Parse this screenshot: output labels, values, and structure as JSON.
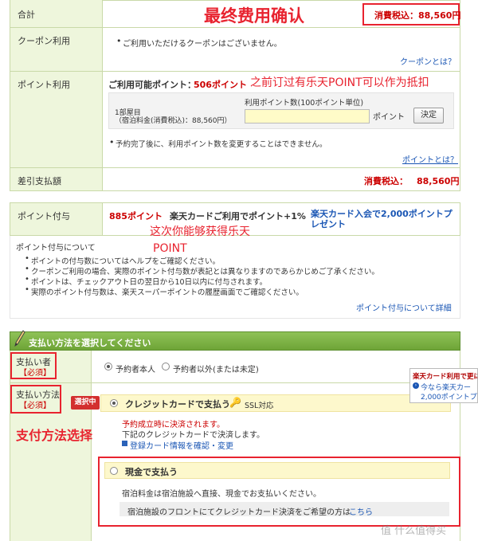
{
  "summary": {
    "total_label": "合計",
    "total_annotation": "最终费用确认",
    "total_value": "消費税込：88,560円",
    "coupon_label": "クーポン利用",
    "coupon_note": "ご利用いただけるクーポンはございません。",
    "coupon_link": "クーポンとは？",
    "point_label": "ポイント利用",
    "point_available_prefix": "ご利用可能ポイント：",
    "point_available_value": "506ポイント",
    "point_annotation": "之前订过有乐天POINT可以作为抵扣",
    "room_label": "1部屋目",
    "room_price": "（宿泊料金(消費税込)：88,560円）",
    "use_points_label": "利用ポイント数(100ポイント単位)",
    "points_unit": "ポイント",
    "decide_button": "決定",
    "points_note": "予約完了後に、利用ポイント数を変更することはできません。",
    "point_link": "ポイントとは？",
    "balance_label": "差引支払額",
    "balance_tax": "消費税込：",
    "balance_value": "88,560円"
  },
  "grant": {
    "label": "ポイント付与",
    "points_value": "885ポイント",
    "card_bonus": "楽天カードご利用でポイント+1%",
    "card_join": "楽天カード入会で2,000ポイントプレゼント",
    "annotation_line1": "POINT",
    "annotation_line2": "这次你能够获得乐天",
    "about_title": "ポイント付与について",
    "notes": [
      "ポイントの付与数についてはヘルプをご確認ください。",
      "クーポンご利用の場合、実際のポイント付与数が表記とは異なりますのであらかじめご了承ください。",
      "ポイントは、チェックアウト日の翌日から10日以内に付与されます。",
      "実際のポイント付与数は、楽天スーパーポイントの履歴画面でご確認ください。"
    ],
    "detail_link": "ポイント付与について詳細"
  },
  "payment": {
    "header": "支払い方法を選択してください",
    "payer_label": "支払い者",
    "required": "【必須】",
    "payer_self": "予約者本人",
    "payer_other": "予約者以外(または未定)",
    "method_label": "支払い方法",
    "selected_badge": "選択中",
    "card_title": "クレジットカードで支払う",
    "ssl": "SSL対応",
    "card_note_red": "予約成立時に決済されます。",
    "card_note": "下記のクレジットカードで決済します。",
    "card_link": "登録カード情報を確認・変更",
    "cash_title": "現金で支払う",
    "cash_note": "宿泊料金は宿泊施設へ直接、現金でお支払いください。",
    "front_note": "宿泊施設のフロントにてクレジットカード決済をご希望の方は",
    "front_link": "こちら",
    "method_annotation": "支付方法选择",
    "promo_title": "楽天カード利用で更に",
    "promo_line1": "今なら楽天カー",
    "promo_line2": "2,000ポイントプ"
  },
  "watermark": "值 什么值得买",
  "colors": {
    "label_bg": "#eef6dc",
    "border": "#c9d9a8",
    "annotation_red": "#e8232f",
    "header_green": "#7db346",
    "price_red": "#cc0000"
  }
}
